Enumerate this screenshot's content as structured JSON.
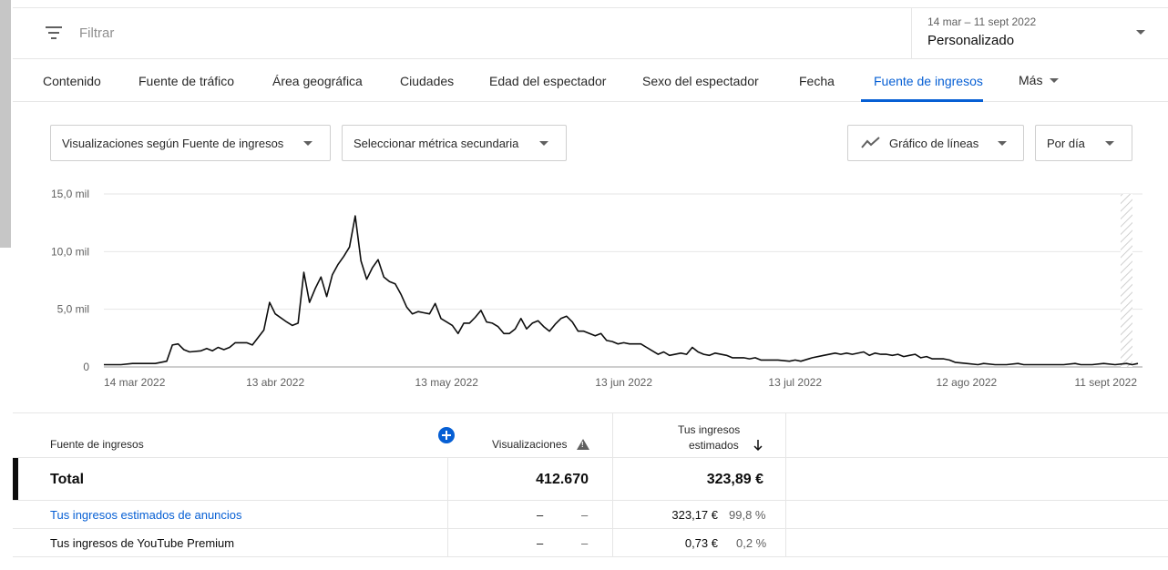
{
  "filter": {
    "placeholder": "Filtrar"
  },
  "date": {
    "range": "14 mar – 11 sept 2022",
    "preset": "Personalizado"
  },
  "tabs": [
    {
      "label": "Contenido"
    },
    {
      "label": "Fuente de tráfico"
    },
    {
      "label": "Área geográfica"
    },
    {
      "label": "Ciudades"
    },
    {
      "label": "Edad del espectador"
    },
    {
      "label": "Sexo del espectador"
    },
    {
      "label": "Fecha"
    },
    {
      "label": "Fuente de ingresos",
      "active": true
    },
    {
      "label": "Más"
    }
  ],
  "controls": {
    "primary_metric": "Visualizaciones según Fuente de ingresos",
    "secondary_metric": "Seleccionar métrica secundaria",
    "chart_type": "Gráfico de líneas",
    "granularity": "Por día"
  },
  "chart_data": {
    "type": "line",
    "title": "",
    "xlabel": "",
    "ylabel": "",
    "ylim": [
      0,
      15000
    ],
    "y_ticks": [
      "0",
      "5,0 mil",
      "10,0 mil",
      "15,0 mil"
    ],
    "x_ticks": [
      {
        "label": "14 mar 2022",
        "date": "2022-03-14"
      },
      {
        "label": "13 abr 2022",
        "date": "2022-04-13"
      },
      {
        "label": "13 may 2022",
        "date": "2022-05-13"
      },
      {
        "label": "13 jun 2022",
        "date": "2022-06-13"
      },
      {
        "label": "13 jul 2022",
        "date": "2022-07-13"
      },
      {
        "label": "12 ago 2022",
        "date": "2022-08-12"
      },
      {
        "label": "11 sept 2022",
        "date": "2022-09-11"
      }
    ],
    "grid": true,
    "series": [
      {
        "points": [
          [
            "2022-03-14",
            200
          ],
          [
            "2022-03-17",
            200
          ],
          [
            "2022-03-19",
            300
          ],
          [
            "2022-03-23",
            300
          ],
          [
            "2022-03-25",
            500
          ],
          [
            "2022-03-26",
            1900
          ],
          [
            "2022-03-27",
            2000
          ],
          [
            "2022-03-28",
            1500
          ],
          [
            "2022-03-29",
            1300
          ],
          [
            "2022-03-31",
            1400
          ],
          [
            "2022-04-01",
            1600
          ],
          [
            "2022-04-02",
            1400
          ],
          [
            "2022-04-03",
            1700
          ],
          [
            "2022-04-04",
            1500
          ],
          [
            "2022-04-05",
            1700
          ],
          [
            "2022-04-06",
            2100
          ],
          [
            "2022-04-08",
            2100
          ],
          [
            "2022-04-09",
            1900
          ],
          [
            "2022-04-11",
            3200
          ],
          [
            "2022-04-12",
            5600
          ],
          [
            "2022-04-13",
            4600
          ],
          [
            "2022-04-15",
            3900
          ],
          [
            "2022-04-16",
            3600
          ],
          [
            "2022-04-17",
            3800
          ],
          [
            "2022-04-18",
            8200
          ],
          [
            "2022-04-19",
            5600
          ],
          [
            "2022-04-20",
            6800
          ],
          [
            "2022-04-21",
            7800
          ],
          [
            "2022-04-22",
            6100
          ],
          [
            "2022-04-23",
            8000
          ],
          [
            "2022-04-24",
            8900
          ],
          [
            "2022-04-25",
            9600
          ],
          [
            "2022-04-26",
            10400
          ],
          [
            "2022-04-27",
            13100
          ],
          [
            "2022-04-28",
            9200
          ],
          [
            "2022-04-29",
            7600
          ],
          [
            "2022-04-30",
            8600
          ],
          [
            "2022-05-01",
            9300
          ],
          [
            "2022-05-02",
            7800
          ],
          [
            "2022-05-03",
            7400
          ],
          [
            "2022-05-04",
            7200
          ],
          [
            "2022-05-05",
            6300
          ],
          [
            "2022-05-06",
            5200
          ],
          [
            "2022-05-07",
            4600
          ],
          [
            "2022-05-08",
            4800
          ],
          [
            "2022-05-09",
            4700
          ],
          [
            "2022-05-10",
            4600
          ],
          [
            "2022-05-11",
            5500
          ],
          [
            "2022-05-12",
            4200
          ],
          [
            "2022-05-13",
            3900
          ],
          [
            "2022-05-14",
            3600
          ],
          [
            "2022-05-15",
            2900
          ],
          [
            "2022-05-16",
            3800
          ],
          [
            "2022-05-17",
            3800
          ],
          [
            "2022-05-18",
            4300
          ],
          [
            "2022-05-19",
            4900
          ],
          [
            "2022-05-20",
            3900
          ],
          [
            "2022-05-21",
            3800
          ],
          [
            "2022-05-22",
            3500
          ],
          [
            "2022-05-23",
            2900
          ],
          [
            "2022-05-24",
            2900
          ],
          [
            "2022-05-25",
            3300
          ],
          [
            "2022-05-26",
            4200
          ],
          [
            "2022-05-27",
            3300
          ],
          [
            "2022-05-28",
            3800
          ],
          [
            "2022-05-29",
            4000
          ],
          [
            "2022-05-30",
            3500
          ],
          [
            "2022-05-31",
            3100
          ],
          [
            "2022-06-01",
            3700
          ],
          [
            "2022-06-02",
            4200
          ],
          [
            "2022-06-03",
            4400
          ],
          [
            "2022-06-04",
            3900
          ],
          [
            "2022-06-05",
            3100
          ],
          [
            "2022-06-06",
            3100
          ],
          [
            "2022-06-07",
            2900
          ],
          [
            "2022-06-08",
            2700
          ],
          [
            "2022-06-09",
            2900
          ],
          [
            "2022-06-10",
            2300
          ],
          [
            "2022-06-11",
            2200
          ],
          [
            "2022-06-12",
            2000
          ],
          [
            "2022-06-13",
            2100
          ],
          [
            "2022-06-14",
            2000
          ],
          [
            "2022-06-16",
            2000
          ],
          [
            "2022-06-17",
            1700
          ],
          [
            "2022-06-18",
            1400
          ],
          [
            "2022-06-19",
            1100
          ],
          [
            "2022-06-20",
            1300
          ],
          [
            "2022-06-21",
            1000
          ],
          [
            "2022-06-23",
            1200
          ],
          [
            "2022-06-24",
            1100
          ],
          [
            "2022-06-25",
            1700
          ],
          [
            "2022-06-26",
            1300
          ],
          [
            "2022-06-27",
            1100
          ],
          [
            "2022-06-28",
            1000
          ],
          [
            "2022-06-29",
            1200
          ],
          [
            "2022-07-01",
            1000
          ],
          [
            "2022-07-02",
            800
          ],
          [
            "2022-07-04",
            800
          ],
          [
            "2022-07-05",
            700
          ],
          [
            "2022-07-06",
            800
          ],
          [
            "2022-07-07",
            600
          ],
          [
            "2022-07-10",
            600
          ],
          [
            "2022-07-12",
            500
          ],
          [
            "2022-07-13",
            600
          ],
          [
            "2022-07-14",
            500
          ],
          [
            "2022-07-16",
            800
          ],
          [
            "2022-07-18",
            1000
          ],
          [
            "2022-07-20",
            1200
          ],
          [
            "2022-07-21",
            1100
          ],
          [
            "2022-07-22",
            1200
          ],
          [
            "2022-07-23",
            1100
          ],
          [
            "2022-07-25",
            1300
          ],
          [
            "2022-07-26",
            1000
          ],
          [
            "2022-07-27",
            1200
          ],
          [
            "2022-07-28",
            1100
          ],
          [
            "2022-07-29",
            1100
          ],
          [
            "2022-07-30",
            1000
          ],
          [
            "2022-07-31",
            1100
          ],
          [
            "2022-08-01",
            900
          ],
          [
            "2022-08-02",
            1000
          ],
          [
            "2022-08-03",
            1100
          ],
          [
            "2022-08-04",
            800
          ],
          [
            "2022-08-05",
            900
          ],
          [
            "2022-08-06",
            700
          ],
          [
            "2022-08-08",
            700
          ],
          [
            "2022-08-09",
            600
          ],
          [
            "2022-08-10",
            400
          ],
          [
            "2022-08-12",
            300
          ],
          [
            "2022-08-14",
            200
          ],
          [
            "2022-08-15",
            300
          ],
          [
            "2022-08-17",
            200
          ],
          [
            "2022-08-19",
            200
          ],
          [
            "2022-08-21",
            300
          ],
          [
            "2022-08-22",
            200
          ],
          [
            "2022-08-24",
            200
          ],
          [
            "2022-08-27",
            200
          ],
          [
            "2022-08-29",
            200
          ],
          [
            "2022-08-31",
            300
          ],
          [
            "2022-09-01",
            200
          ],
          [
            "2022-09-03",
            200
          ],
          [
            "2022-09-05",
            300
          ],
          [
            "2022-09-07",
            200
          ],
          [
            "2022-09-09",
            300
          ],
          [
            "2022-09-10",
            200
          ],
          [
            "2022-09-11",
            300
          ]
        ]
      }
    ]
  },
  "table": {
    "headers": {
      "dimension": "Fuente de ingresos",
      "views": "Visualizaciones",
      "revenue_line1": "Tus ingresos",
      "revenue_line2": "estimados"
    },
    "total": {
      "label": "Total",
      "views": "412.670",
      "revenue": "323,89 €"
    },
    "rows": [
      {
        "label": "Tus ingresos estimados de anuncios",
        "views": "–",
        "views_pct": "–",
        "revenue": "323,17 €",
        "revenue_pct": "99,8 %"
      },
      {
        "label": "Tus ingresos de YouTube Premium",
        "views": "–",
        "views_pct": "–",
        "revenue": "0,73 €",
        "revenue_pct": "0,2 %"
      }
    ]
  },
  "colors": {
    "accent": "#065fd4",
    "line": "#0d0d0d",
    "grid": "#e6e6e6"
  },
  "icons": [
    "filter-icon",
    "chevron-down-icon",
    "line-chart-icon",
    "add-column-icon",
    "warning-icon",
    "arrow-down-icon"
  ]
}
